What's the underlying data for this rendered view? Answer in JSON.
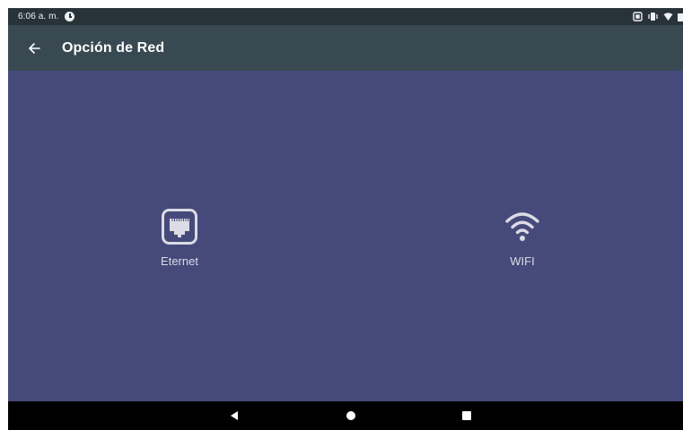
{
  "status_bar": {
    "time": "6:06 a. m.",
    "icons": [
      "alarm-icon",
      "screenshot-icon",
      "vibrate-icon",
      "wifi-signal-icon",
      "battery-icon"
    ]
  },
  "app_bar": {
    "back_icon": "arrow-left-icon",
    "title": "Opción de Red"
  },
  "options": [
    {
      "label": "Eternet",
      "icon": "ethernet-icon"
    },
    {
      "label": "WIFI",
      "icon": "wifi-icon"
    }
  ],
  "nav_bar": {
    "buttons": [
      "back-triangle-icon",
      "home-circle-icon",
      "recents-square-icon"
    ]
  },
  "colors": {
    "status_bar": "#283239",
    "app_bar": "#384952",
    "background": "#464a7a",
    "nav_bar": "#000000",
    "icon": "#dcdbe6"
  }
}
